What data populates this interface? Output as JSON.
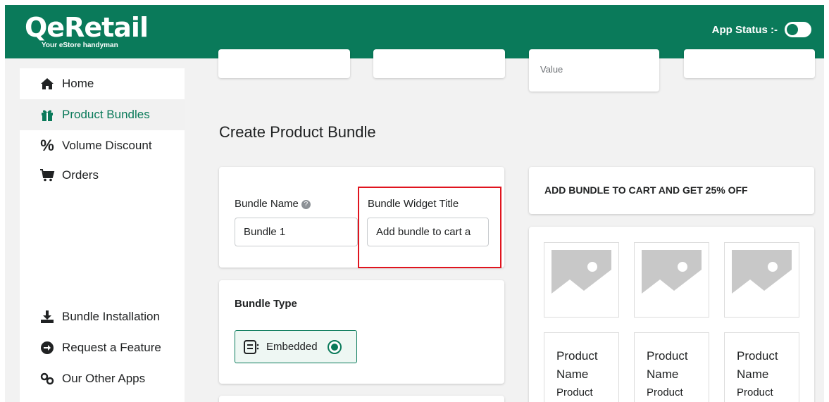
{
  "header": {
    "logo_text": "QeRetail",
    "logo_tagline": "Your eStore handyman",
    "app_status_label": "App Status :-"
  },
  "sidebar": {
    "items": [
      {
        "label": "Home",
        "icon": "home-icon"
      },
      {
        "label": "Product Bundles",
        "icon": "gift-icon",
        "active": true
      },
      {
        "label": "Volume Discount",
        "icon": "percent-icon"
      },
      {
        "label": "Orders",
        "icon": "cart-icon"
      }
    ],
    "bottom_items": [
      {
        "label": "Bundle Installation",
        "icon": "download-icon"
      },
      {
        "label": "Request a Feature",
        "icon": "arrow-circle-icon"
      },
      {
        "label": "Our Other Apps",
        "icon": "link-icon"
      }
    ]
  },
  "stats": {
    "partial_label": "Value"
  },
  "page": {
    "title": "Create Product Bundle"
  },
  "form": {
    "bundle_name_label": "Bundle Name",
    "bundle_name_value": "Bundle 1",
    "widget_title_label": "Bundle Widget Title",
    "widget_title_value": "Add bundle to cart a",
    "bundle_type_label": "Bundle Type",
    "bundle_type_option": "Embedded"
  },
  "preview": {
    "promo_text": "ADD BUNDLE TO CART AND GET 25% OFF",
    "products": [
      {
        "name": "Product Name",
        "sub": "Product"
      },
      {
        "name": "Product Name",
        "sub": "Product"
      },
      {
        "name": "Product Name",
        "sub": "Product"
      }
    ]
  },
  "colors": {
    "brand": "#0a7a5a",
    "highlight": "#e0141e"
  }
}
